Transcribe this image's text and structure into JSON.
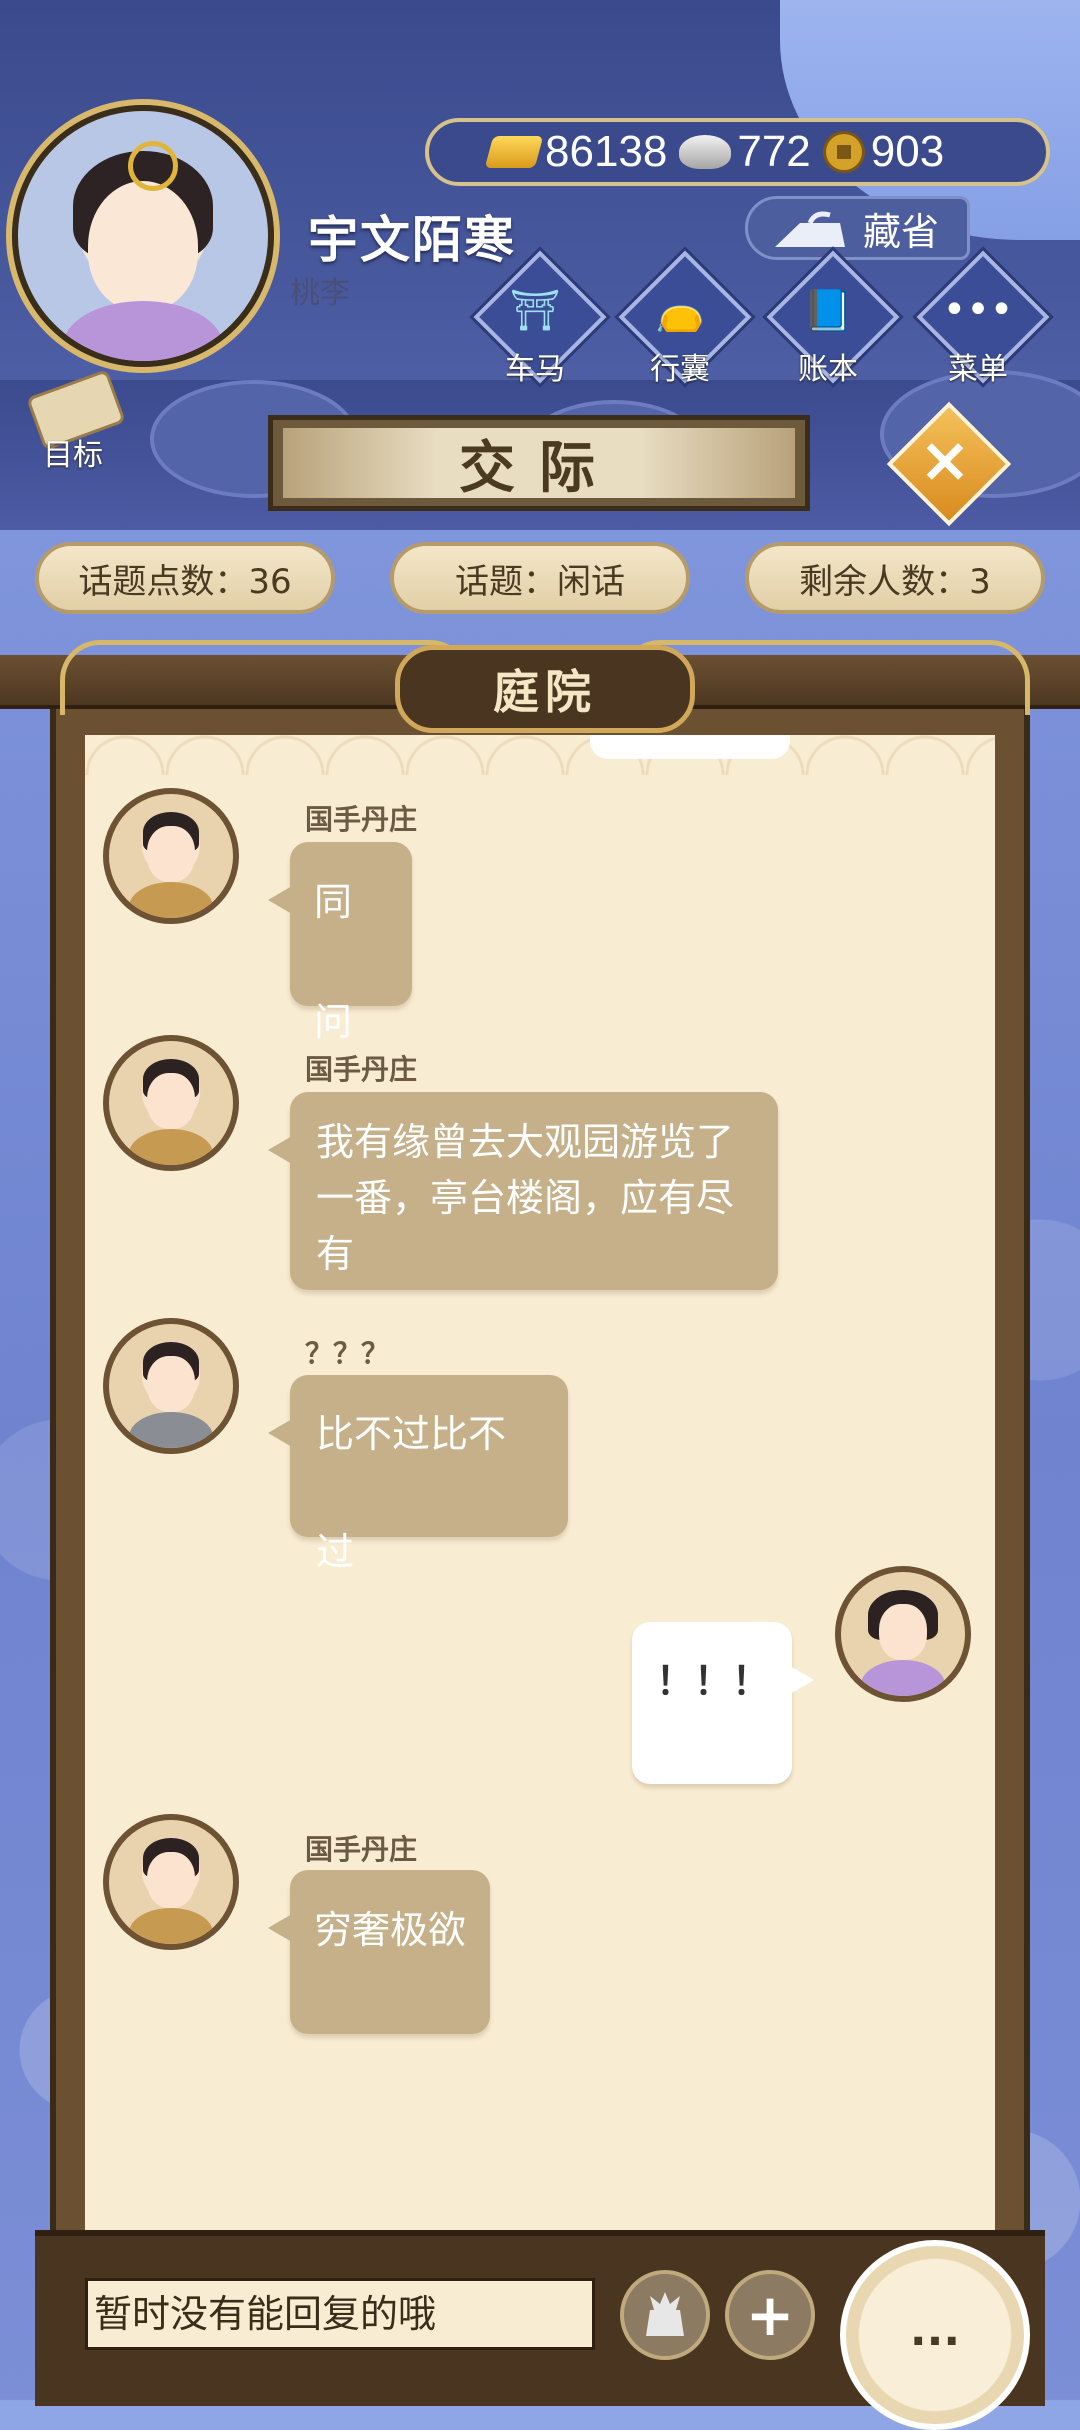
{
  "player": {
    "name": "宇文陌寒",
    "subtitle": "桃李"
  },
  "currency": {
    "gold": "86138",
    "silver": "772",
    "coin": "903"
  },
  "hide_button": {
    "label": "藏省"
  },
  "menu": [
    {
      "label": "车马",
      "icon": "carriage-icon"
    },
    {
      "label": "行囊",
      "icon": "bag-icon"
    },
    {
      "label": "账本",
      "icon": "ledger-icon"
    },
    {
      "label": "菜单",
      "icon": "more-dots-icon"
    }
  ],
  "goal": {
    "label": "目标"
  },
  "title": "交际",
  "status": {
    "topic_points": "话题点数：36",
    "topic": "话题：闲话",
    "remaining": "剩余人数：3"
  },
  "room": "庭院",
  "messages": [
    {
      "sender": "国手丹庄",
      "text": "同问"
    },
    {
      "sender": "国手丹庄",
      "text": "我有缘曾去大观园游览了一番，亭台楼阁，应有尽有"
    },
    {
      "sender": "？？？",
      "text": "比不过比不过"
    },
    {
      "sender": "",
      "text": "！！！"
    },
    {
      "sender": "国手丹庄",
      "text": "穷奢极欲"
    }
  ],
  "reply": {
    "placeholder": "暂时没有能回复的哦",
    "more": "..."
  },
  "colors": {
    "bubble": "#c5b08a",
    "panel": "#f8ecd3",
    "header": "#3a4a8c"
  }
}
